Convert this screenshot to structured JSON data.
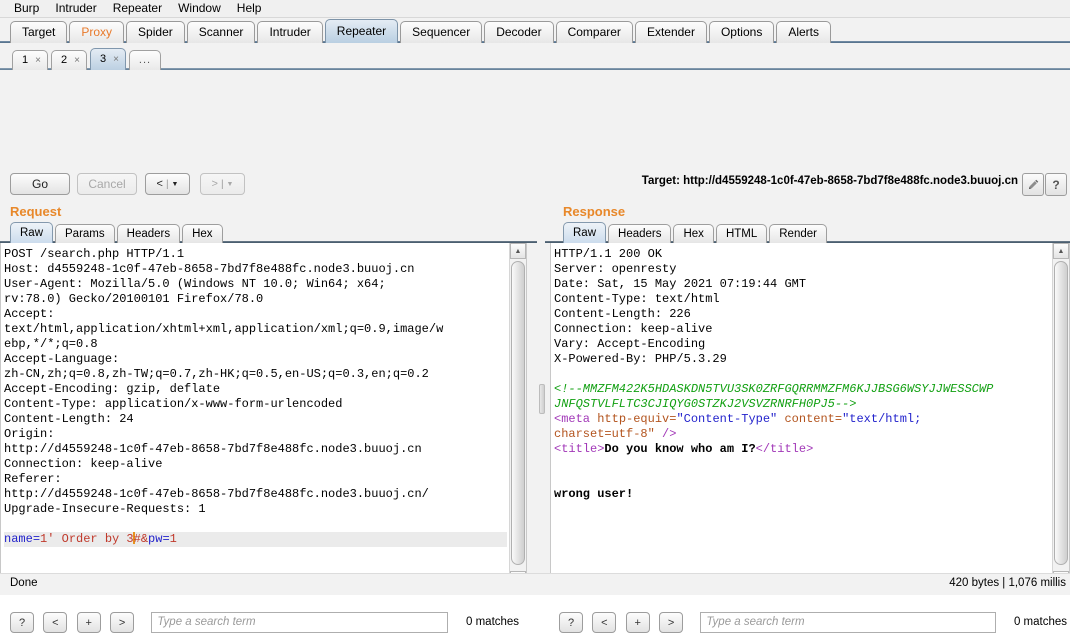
{
  "menu": {
    "items": [
      "Burp",
      "Intruder",
      "Repeater",
      "Window",
      "Help"
    ]
  },
  "main_tabs": [
    {
      "label": "Target",
      "selected": false
    },
    {
      "label": "Proxy",
      "selected": false
    },
    {
      "label": "Spider",
      "selected": false
    },
    {
      "label": "Scanner",
      "selected": false
    },
    {
      "label": "Intruder",
      "selected": false
    },
    {
      "label": "Repeater",
      "selected": true
    },
    {
      "label": "Sequencer",
      "selected": false
    },
    {
      "label": "Decoder",
      "selected": false
    },
    {
      "label": "Comparer",
      "selected": false
    },
    {
      "label": "Extender",
      "selected": false
    },
    {
      "label": "Options",
      "selected": false
    },
    {
      "label": "Alerts",
      "selected": false
    }
  ],
  "repeater_tabs": [
    {
      "label": "1",
      "close": "×",
      "selected": false
    },
    {
      "label": "2",
      "close": "×",
      "selected": false
    },
    {
      "label": "3",
      "close": "×",
      "selected": true
    },
    {
      "label": "...",
      "close": "",
      "selected": false
    }
  ],
  "toolbar": {
    "go_label": "Go",
    "cancel_label": "Cancel",
    "back_arrow": "<",
    "forward_arrow": ">",
    "separator": "|",
    "caret": "▼",
    "target_label": "Target: http://d4559248-1c0f-47eb-8658-7bd7f8e488fc.node3.buuoj.cn",
    "help_label": "?"
  },
  "request": {
    "title": "Request",
    "tabs": [
      {
        "label": "Raw",
        "selected": true
      },
      {
        "label": "Params",
        "selected": false
      },
      {
        "label": "Headers",
        "selected": false
      },
      {
        "label": "Hex",
        "selected": false
      }
    ],
    "headers_text": "POST /search.php HTTP/1.1\nHost: d4559248-1c0f-47eb-8658-7bd7f8e488fc.node3.buuoj.cn\nUser-Agent: Mozilla/5.0 (Windows NT 10.0; Win64; x64;\nrv:78.0) Gecko/20100101 Firefox/78.0\nAccept:\ntext/html,application/xhtml+xml,application/xml;q=0.9,image/w\nebp,*/*;q=0.8\nAccept-Language:\nzh-CN,zh;q=0.8,zh-TW;q=0.7,zh-HK;q=0.5,en-US;q=0.3,en;q=0.2\nAccept-Encoding: gzip, deflate\nContent-Type: application/x-www-form-urlencoded\nContent-Length: 24\nOrigin:\nhttp://d4559248-1c0f-47eb-8658-7bd7f8e488fc.node3.buuoj.cn\nConnection: keep-alive\nReferer:\nhttp://d4559248-1c0f-47eb-8658-7bd7f8e488fc.node3.buuoj.cn/\nUpgrade-Insecure-Requests: 1",
    "body": {
      "param1_name": "name",
      "eq": "=",
      "param1_value": "1' Order by 3",
      "after_caret": "#",
      "amp": "&",
      "param2_name": "pw",
      "param2_value": "1"
    },
    "find": {
      "help_label": "?",
      "prev_label": "<",
      "add_label": "+",
      "next_label": ">",
      "placeholder": "Type a search term",
      "matches": "0 matches"
    }
  },
  "response": {
    "title": "Response",
    "tabs": [
      {
        "label": "Raw",
        "selected": true
      },
      {
        "label": "Headers",
        "selected": false
      },
      {
        "label": "Hex",
        "selected": false
      },
      {
        "label": "HTML",
        "selected": false
      },
      {
        "label": "Render",
        "selected": false
      }
    ],
    "headers_text": "HTTP/1.1 200 OK\nServer: openresty\nDate: Sat, 15 May 2021 07:19:44 GMT\nContent-Type: text/html\nContent-Length: 226\nConnection: keep-alive\nVary: Accept-Encoding\nX-Powered-By: PHP/5.3.29",
    "body": {
      "comment_line1": "<!--MMZFM422K5HDASKDN5TVU3SK0ZRFGQRRMMZFM6KJJBSG6WSYJJWESSCWP",
      "comment_line2": "JNFQSTVLFLTC3CJIQYG0STZKJ2VSVZRNRFH0PJ5-->",
      "meta_tag_open": "<meta",
      "meta_attr1": " http-equiv=",
      "meta_val1": "\"Content-Type\"",
      "meta_attr2": " content=",
      "meta_val2": "\"text/html;",
      "meta_val3": "charset=utf-8\"",
      "meta_close": " />",
      "title_open": "<title>",
      "title_text": "Do you know who am I?",
      "title_close": "</title>",
      "message": "wrong user!"
    },
    "find": {
      "help_label": "?",
      "prev_label": "<",
      "add_label": "+",
      "next_label": ">",
      "placeholder": "Type a search term",
      "matches": "0 matches"
    }
  },
  "status": {
    "left": "Done",
    "right": "420 bytes | 1,076 millis"
  }
}
